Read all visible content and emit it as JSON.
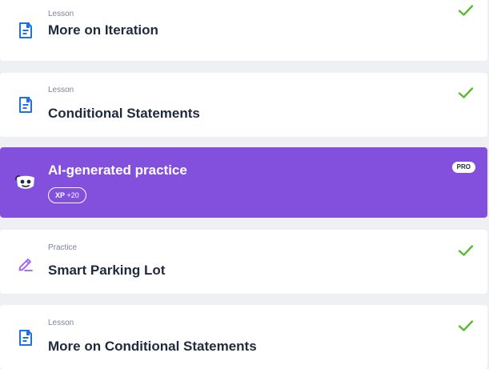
{
  "colors": {
    "background": "#eef0f4",
    "card": "#ffffff",
    "ai_card": "#8350dd",
    "icon_blue": "#1b6ff0",
    "practice_purple": "#9b5cff",
    "check_green": "#5bbb2f",
    "title_text": "#1f2a3d",
    "kind_text": "#7a8396"
  },
  "items": [
    {
      "kind": "Lesson",
      "title": "More on Iteration",
      "icon": "document-icon",
      "completed": true
    },
    {
      "kind": "Lesson",
      "title": "Conditional Statements",
      "icon": "document-icon",
      "completed": true
    },
    {
      "title": "AI-generated practice",
      "icon": "robot-mascot-icon",
      "xp_label": "XP",
      "xp_value": "+20",
      "pro_badge": "PRO"
    },
    {
      "kind": "Practice",
      "title": "Smart Parking Lot",
      "icon": "pencil-icon",
      "completed": true
    },
    {
      "kind": "Lesson",
      "title": "More on Conditional Statements",
      "icon": "document-icon",
      "completed": true
    }
  ]
}
